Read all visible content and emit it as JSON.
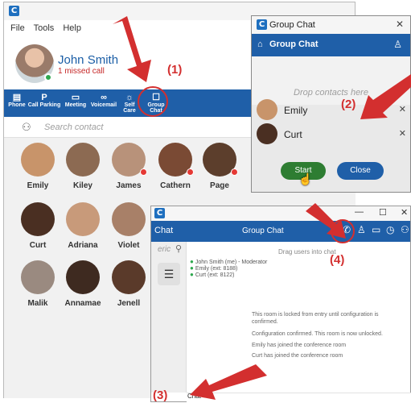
{
  "main": {
    "menu": [
      "File",
      "Tools",
      "Help"
    ],
    "user_name": "John Smith",
    "missed_calls": "1 missed call",
    "toolbar": [
      {
        "label": "Phone",
        "icon": "phone-icon",
        "glyph": "▤"
      },
      {
        "label": "Call Parking",
        "icon": "call-parking-icon",
        "glyph": "P"
      },
      {
        "label": "Meeting",
        "icon": "meeting-icon",
        "glyph": "▭"
      },
      {
        "label": "Voicemail",
        "icon": "voicemail-icon",
        "glyph": "∞"
      },
      {
        "label": "Self Care",
        "icon": "self-care-icon",
        "glyph": "☼"
      },
      {
        "label": "Group Chat",
        "icon": "group-chat-icon",
        "glyph": "☐"
      }
    ],
    "search_placeholder": "Search contact",
    "contacts": [
      {
        "name": "Emily",
        "color": "#c8946a",
        "busy": false
      },
      {
        "name": "Kiley",
        "color": "#8c6a52",
        "busy": false
      },
      {
        "name": "James",
        "color": "#b8927a",
        "busy": true
      },
      {
        "name": "Cathern",
        "color": "#7a4a34",
        "busy": true
      },
      {
        "name": "Page",
        "color": "#5c3e2c",
        "busy": true
      },
      {
        "name": "Curt",
        "color": "#4a2f22",
        "busy": false
      },
      {
        "name": "Adriana",
        "color": "#c89a7a",
        "busy": false
      },
      {
        "name": "Violet",
        "color": "#a88068",
        "busy": false
      },
      {
        "name": "Malik",
        "color": "#9a8a80",
        "busy": false
      },
      {
        "name": "Annamae",
        "color": "#3e2a20",
        "busy": false
      },
      {
        "name": "Jenell",
        "color": "#5a3a2a",
        "busy": false
      }
    ]
  },
  "group_chat": {
    "window_title": "Group Chat",
    "bar_title": "Group Chat",
    "drop_text": "Drop contacts here",
    "participants": [
      {
        "name": "Emily",
        "color": "#c8946a"
      },
      {
        "name": "Curt",
        "color": "#4a2f22"
      }
    ],
    "start_label": "Start",
    "close_label": "Close"
  },
  "chat": {
    "bar_label": "Chat",
    "title": "Group Chat",
    "search_text": "eric",
    "drag_hint": "Drag users into chat",
    "members": [
      "John Smith (me) - Moderator",
      "Emily (ext: 8188)",
      "Curt (ext: 8122)"
    ],
    "messages": [
      "This room is locked from entry until configuration is confirmed.",
      "Configuration confirmed. This room is now unlocked.",
      "Emily has joined the conference room",
      "Curt has joined the conference room"
    ],
    "input_value": "Chat"
  },
  "annotations": [
    "(1)",
    "(2)",
    "(3)",
    "(4)"
  ],
  "colors": {
    "accent": "#1f5fa8",
    "annotation": "#d32f2f",
    "start_button": "#2e7d32",
    "close_button": "#1f5fa8"
  }
}
